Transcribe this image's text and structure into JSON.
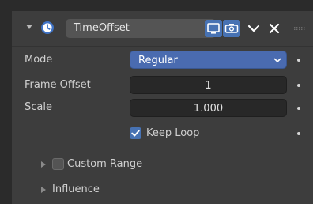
{
  "modifier": {
    "name": "TimeOffset",
    "icon": "clock-icon",
    "header_buttons": [
      "viewport-toggle-icon",
      "render-toggle-icon",
      "chevron-down-icon",
      "close-icon"
    ],
    "accent_color": "#4772b3"
  },
  "properties": {
    "mode_label": "Mode",
    "mode_value": "Regular",
    "frame_offset_label": "Frame Offset",
    "frame_offset_value": "1",
    "scale_label": "Scale",
    "scale_value": "1.000",
    "keep_loop_label": "Keep Loop",
    "keep_loop_checked": true
  },
  "subpanels": [
    {
      "label": "Custom Range",
      "has_checkbox": true,
      "checked": false
    },
    {
      "label": "Influence",
      "has_checkbox": false
    }
  ]
}
